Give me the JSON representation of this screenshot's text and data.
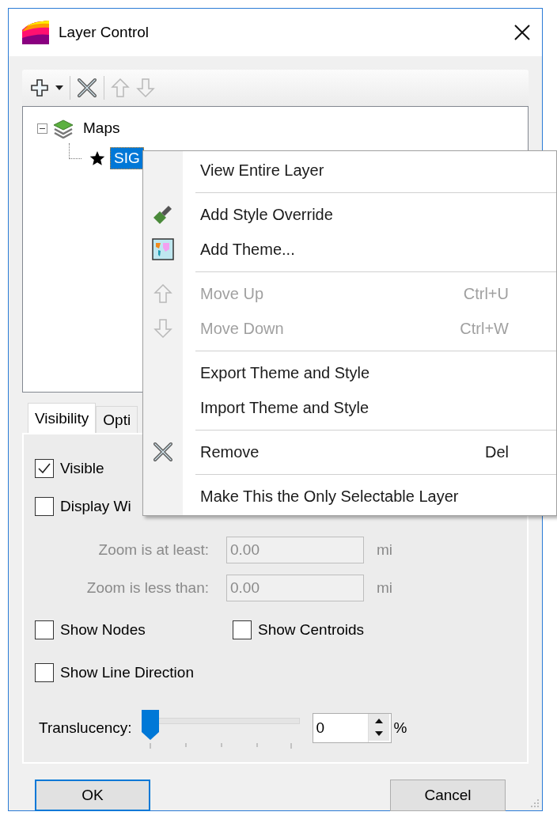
{
  "window": {
    "title": "Layer Control"
  },
  "toolbar": [
    {
      "kind": "add",
      "disabled": false
    },
    {
      "kind": "remove",
      "disabled": false
    },
    {
      "kind": "up",
      "disabled": true
    },
    {
      "kind": "down",
      "disabled": true
    }
  ],
  "tree": {
    "items": [
      {
        "label": "Maps",
        "expanded": true,
        "selected": false,
        "children": [
          {
            "label": "SIG",
            "selected": true
          }
        ]
      }
    ]
  },
  "tabs": [
    {
      "label": "Visibility",
      "selected": true
    },
    {
      "label": "Opti",
      "selected": false
    }
  ],
  "visibility": {
    "visible": {
      "label": "Visible",
      "checked": true
    },
    "display_within": {
      "label": "Display Wi",
      "checked": false
    },
    "zoom_fields": [
      {
        "label": "Zoom is at least:",
        "value": "0.00",
        "unit": "mi",
        "disabled": true
      },
      {
        "label": "Zoom is less than:",
        "value": "0.00",
        "unit": "mi",
        "disabled": true
      }
    ],
    "show_nodes": {
      "label": "Show Nodes",
      "checked": false
    },
    "show_centroids": {
      "label": "Show Centroids",
      "checked": false
    },
    "show_line_direction": {
      "label": "Show Line Direction",
      "checked": false
    },
    "translucency": {
      "label": "Translucency:",
      "level": 0,
      "value": "0",
      "unit": "%"
    }
  },
  "buttons": [
    {
      "label": "OK",
      "default": true
    },
    {
      "label": "Cancel",
      "default": false
    }
  ],
  "context_menu": {
    "items": [
      {
        "kind": "item",
        "label": "View Entire Layer",
        "disabled": false
      },
      {
        "kind": "separator"
      },
      {
        "kind": "item",
        "label": "Add Style Override",
        "disabled": false
      },
      {
        "kind": "item",
        "label": "Add Theme...",
        "disabled": false
      },
      {
        "kind": "separator"
      },
      {
        "kind": "item",
        "label": "Move Up",
        "shortcut": "Ctrl+U",
        "disabled": true
      },
      {
        "kind": "item",
        "label": "Move Down",
        "shortcut": "Ctrl+W",
        "disabled": true
      },
      {
        "kind": "separator"
      },
      {
        "kind": "item",
        "label": "Export Theme and Style",
        "disabled": false
      },
      {
        "kind": "item",
        "label": "Import Theme and Style",
        "disabled": false
      },
      {
        "kind": "separator"
      },
      {
        "kind": "item",
        "label": "Remove",
        "shortcut": "Del",
        "disabled": false
      },
      {
        "kind": "separator"
      },
      {
        "kind": "item",
        "label": "Make This the Only Selectable Layer",
        "disabled": false
      }
    ]
  }
}
